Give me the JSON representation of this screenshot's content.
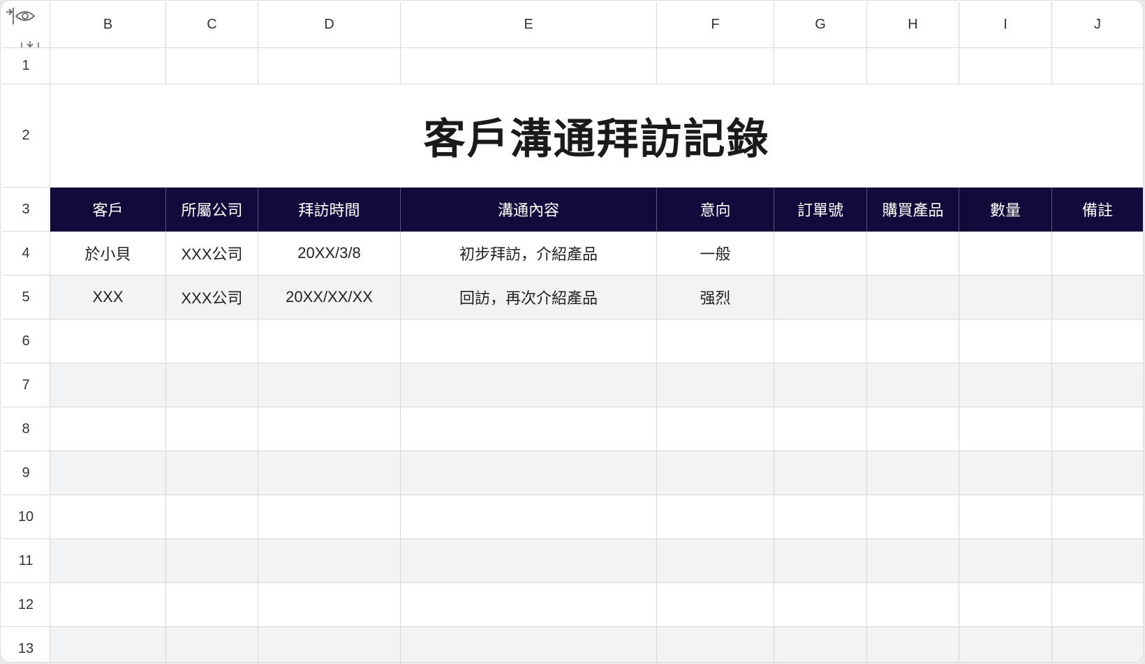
{
  "sheet": {
    "title": "客戶溝通拜訪記錄",
    "column_letters": [
      "B",
      "C",
      "D",
      "E",
      "F",
      "G",
      "H",
      "I",
      "J"
    ],
    "row_numbers": [
      "1",
      "2",
      "3",
      "4",
      "5",
      "6",
      "7",
      "8",
      "9",
      "10",
      "11",
      "12",
      "13"
    ],
    "header_fill_color": "#130a3c",
    "headers": [
      "客戶",
      "所屬公司",
      "拜訪時間",
      "溝通內容",
      "意向",
      "訂單號",
      "購買產品",
      "數量",
      "備註"
    ],
    "rows": [
      [
        "於小貝",
        "XXX公司",
        "20XX/3/8",
        "初步拜訪，介紹產品",
        "一般",
        "",
        "",
        "",
        ""
      ],
      [
        "XXX",
        "XXX公司",
        "20XX/XX/XX",
        "回訪，再次介紹產品",
        "强烈",
        "",
        "",
        "",
        ""
      ]
    ],
    "icons": [
      "freeze-eye-icon",
      "collapse-rows-icon"
    ]
  }
}
